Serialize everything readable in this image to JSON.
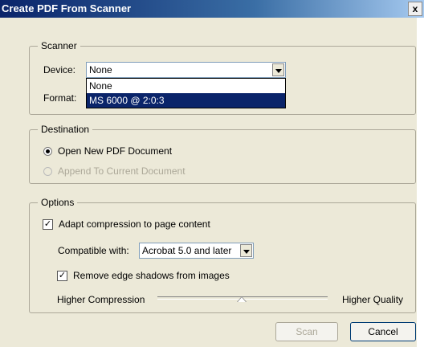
{
  "window": {
    "title": "Create PDF From Scanner",
    "close_glyph": "x"
  },
  "scanner": {
    "group_title": "Scanner",
    "device_label": "Device:",
    "device_value": "None",
    "device_options": [
      "None",
      "MS 6000 @ 2:0:3"
    ],
    "format_label": "Format:"
  },
  "destination": {
    "group_title": "Destination",
    "open_new": "Open New PDF Document",
    "append": "Append To Current Document"
  },
  "options": {
    "group_title": "Options",
    "adapt_compression": "Adapt compression to page content",
    "compatible_label": "Compatible with:",
    "compatible_value": "Acrobat 5.0 and later",
    "remove_shadows": "Remove edge shadows from images",
    "slider_left": "Higher Compression",
    "slider_right": "Higher Quality"
  },
  "buttons": {
    "scan": "Scan",
    "cancel": "Cancel"
  }
}
